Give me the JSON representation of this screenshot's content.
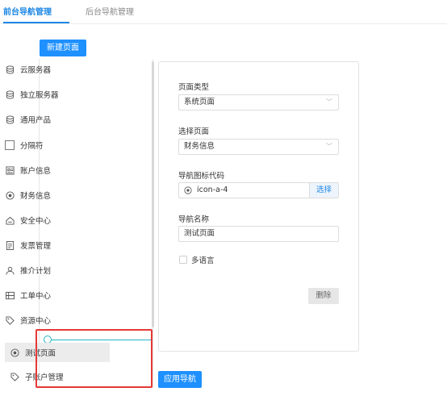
{
  "tabs": [
    {
      "label": "前台导航管理",
      "active": true
    },
    {
      "label": "后台导航管理",
      "active": false
    }
  ],
  "buttons": {
    "new_page": "新建页面",
    "apply_nav": "应用导航",
    "delete": "删除",
    "choose": "选择"
  },
  "nav_list": {
    "items": [
      {
        "label": "云服务器",
        "icon": "database-icon"
      },
      {
        "label": "独立服务器",
        "icon": "database-icon"
      },
      {
        "label": "通用产品",
        "icon": "database-icon"
      },
      {
        "label": "分隔符",
        "icon": "separator-box-icon"
      },
      {
        "label": "账户信息",
        "icon": "id-card-icon"
      },
      {
        "label": "财务信息",
        "icon": "circle-dot-icon"
      },
      {
        "label": "安全中心",
        "icon": "home-lock-icon"
      },
      {
        "label": "发票管理",
        "icon": "invoice-icon"
      },
      {
        "label": "推介计划",
        "icon": "user-icon"
      },
      {
        "label": "工单中心",
        "icon": "ticket-icon"
      },
      {
        "label": "资源中心",
        "icon": "tag-icon"
      },
      {
        "label": "测试页面",
        "icon": "circle-dot-icon",
        "selected": true
      },
      {
        "label": "子账户管理",
        "icon": "tag-icon"
      }
    ]
  },
  "form": {
    "page_type_label": "页面类型",
    "page_type_value": "系统页面",
    "select_page_label": "选择页面",
    "select_page_value": "财务信息",
    "nav_icon_label": "导航图标代码",
    "nav_icon_value": "icon-a-4",
    "nav_name_label": "导航名称",
    "nav_name_value": "测试页面",
    "multilang_label": "多语言"
  },
  "colors": {
    "primary": "#1e90ff",
    "highlight_box": "#e53935",
    "drag_indicator": "#26b6c4"
  }
}
